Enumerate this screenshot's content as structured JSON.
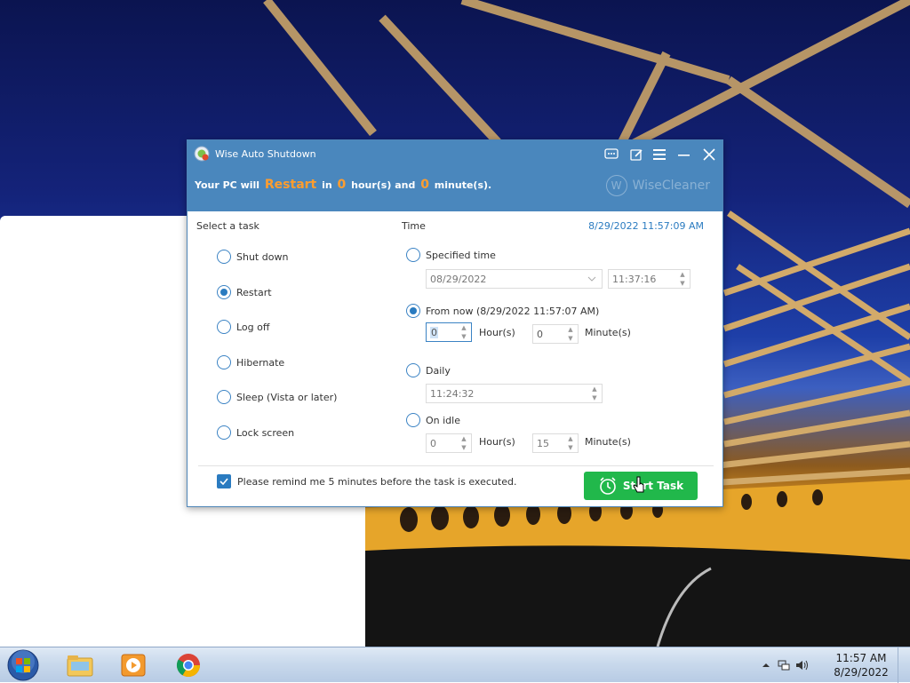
{
  "window": {
    "title": "Wise Auto Shutdown",
    "status": {
      "prefix": "Your PC will",
      "action": "Restart",
      "in": "in",
      "hours": "0",
      "hours_unit": "hour(s) and",
      "minutes": "0",
      "minutes_unit": "minute(s)."
    },
    "brand": "WiseCleaner",
    "brand_initial": "W"
  },
  "task": {
    "heading": "Select a task",
    "options": [
      {
        "label": "Shut down",
        "checked": false
      },
      {
        "label": "Restart",
        "checked": true
      },
      {
        "label": "Log off",
        "checked": false
      },
      {
        "label": "Hibernate",
        "checked": false
      },
      {
        "label": "Sleep (Vista or later)",
        "checked": false
      },
      {
        "label": "Lock screen",
        "checked": false
      }
    ]
  },
  "time": {
    "heading": "Time",
    "current": "8/29/2022 11:57:09 AM",
    "specified": {
      "label": "Specified time",
      "date": "08/29/2022",
      "time": "11:37:16"
    },
    "from_now": {
      "label": "From now (8/29/2022 11:57:07 AM)",
      "hours": "0",
      "hours_unit": "Hour(s)",
      "minutes": "0",
      "minutes_unit": "Minute(s)"
    },
    "daily": {
      "label": "Daily",
      "time": "11:24:32"
    },
    "idle": {
      "label": "On idle",
      "hours": "0",
      "hours_unit": "Hour(s)",
      "minutes": "15",
      "minutes_unit": "Minute(s)"
    }
  },
  "reminder": {
    "label": "Please remind me 5 minutes before the task is executed.",
    "checked": true
  },
  "start_button": "Start Task",
  "taskbar": {
    "clock_time": "11:57 AM",
    "clock_date": "8/29/2022"
  },
  "colors": {
    "header": "#4a87bd",
    "accent": "#2a7bc0",
    "highlight": "#ff9d2e",
    "start_button": "#21b84b"
  }
}
